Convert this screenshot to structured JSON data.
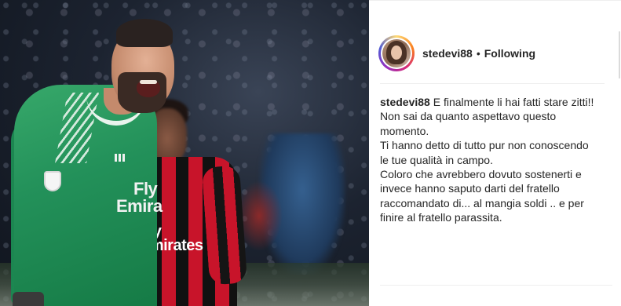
{
  "post": {
    "photo": {
      "keeper_shirt_text": [
        "Fly",
        "Emira"
      ],
      "player2_shirt_text": [
        "Fly",
        "Emirates"
      ]
    },
    "header": {
      "username": "stedevi88",
      "separator": "•",
      "follow_state": "Following"
    },
    "caption": {
      "username": "stedevi88",
      "lines": [
        " E finalmente li hai fatti stare zitti!!",
        "Non sai da quanto aspettavo questo",
        "momento.",
        "Ti hanno detto di tutto pur non conoscendo",
        "le tue qualità in campo.",
        "Coloro che avrebbero dovuto sostenerti e",
        "invece hanno saputo darti del fratello",
        "raccomandato di... al mangia soldi .. e per",
        "finire al fratello parassita."
      ]
    }
  },
  "colors": {
    "text": "#262626",
    "divider": "#efefef",
    "keeper_green": "#23915a",
    "milan_red": "#c8142a"
  }
}
